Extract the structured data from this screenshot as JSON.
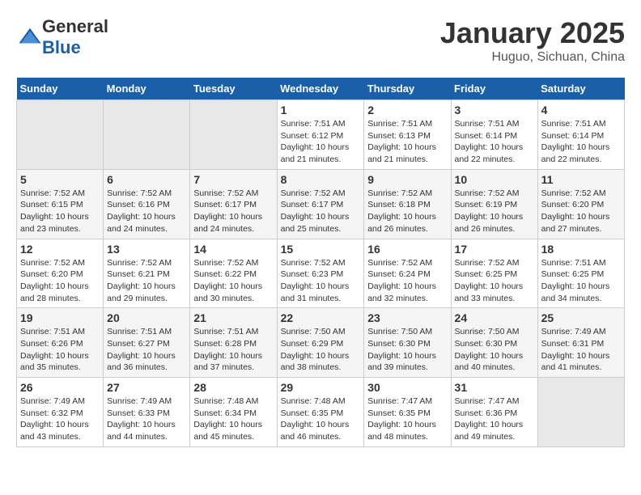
{
  "header": {
    "logo_general": "General",
    "logo_blue": "Blue",
    "month": "January 2025",
    "location": "Huguo, Sichuan, China"
  },
  "weekdays": [
    "Sunday",
    "Monday",
    "Tuesday",
    "Wednesday",
    "Thursday",
    "Friday",
    "Saturday"
  ],
  "weeks": [
    [
      {
        "day": "",
        "info": ""
      },
      {
        "day": "",
        "info": ""
      },
      {
        "day": "",
        "info": ""
      },
      {
        "day": "1",
        "info": "Sunrise: 7:51 AM\nSunset: 6:12 PM\nDaylight: 10 hours\nand 21 minutes."
      },
      {
        "day": "2",
        "info": "Sunrise: 7:51 AM\nSunset: 6:13 PM\nDaylight: 10 hours\nand 21 minutes."
      },
      {
        "day": "3",
        "info": "Sunrise: 7:51 AM\nSunset: 6:14 PM\nDaylight: 10 hours\nand 22 minutes."
      },
      {
        "day": "4",
        "info": "Sunrise: 7:51 AM\nSunset: 6:14 PM\nDaylight: 10 hours\nand 22 minutes."
      }
    ],
    [
      {
        "day": "5",
        "info": "Sunrise: 7:52 AM\nSunset: 6:15 PM\nDaylight: 10 hours\nand 23 minutes."
      },
      {
        "day": "6",
        "info": "Sunrise: 7:52 AM\nSunset: 6:16 PM\nDaylight: 10 hours\nand 24 minutes."
      },
      {
        "day": "7",
        "info": "Sunrise: 7:52 AM\nSunset: 6:17 PM\nDaylight: 10 hours\nand 24 minutes."
      },
      {
        "day": "8",
        "info": "Sunrise: 7:52 AM\nSunset: 6:17 PM\nDaylight: 10 hours\nand 25 minutes."
      },
      {
        "day": "9",
        "info": "Sunrise: 7:52 AM\nSunset: 6:18 PM\nDaylight: 10 hours\nand 26 minutes."
      },
      {
        "day": "10",
        "info": "Sunrise: 7:52 AM\nSunset: 6:19 PM\nDaylight: 10 hours\nand 26 minutes."
      },
      {
        "day": "11",
        "info": "Sunrise: 7:52 AM\nSunset: 6:20 PM\nDaylight: 10 hours\nand 27 minutes."
      }
    ],
    [
      {
        "day": "12",
        "info": "Sunrise: 7:52 AM\nSunset: 6:20 PM\nDaylight: 10 hours\nand 28 minutes."
      },
      {
        "day": "13",
        "info": "Sunrise: 7:52 AM\nSunset: 6:21 PM\nDaylight: 10 hours\nand 29 minutes."
      },
      {
        "day": "14",
        "info": "Sunrise: 7:52 AM\nSunset: 6:22 PM\nDaylight: 10 hours\nand 30 minutes."
      },
      {
        "day": "15",
        "info": "Sunrise: 7:52 AM\nSunset: 6:23 PM\nDaylight: 10 hours\nand 31 minutes."
      },
      {
        "day": "16",
        "info": "Sunrise: 7:52 AM\nSunset: 6:24 PM\nDaylight: 10 hours\nand 32 minutes."
      },
      {
        "day": "17",
        "info": "Sunrise: 7:52 AM\nSunset: 6:25 PM\nDaylight: 10 hours\nand 33 minutes."
      },
      {
        "day": "18",
        "info": "Sunrise: 7:51 AM\nSunset: 6:25 PM\nDaylight: 10 hours\nand 34 minutes."
      }
    ],
    [
      {
        "day": "19",
        "info": "Sunrise: 7:51 AM\nSunset: 6:26 PM\nDaylight: 10 hours\nand 35 minutes."
      },
      {
        "day": "20",
        "info": "Sunrise: 7:51 AM\nSunset: 6:27 PM\nDaylight: 10 hours\nand 36 minutes."
      },
      {
        "day": "21",
        "info": "Sunrise: 7:51 AM\nSunset: 6:28 PM\nDaylight: 10 hours\nand 37 minutes."
      },
      {
        "day": "22",
        "info": "Sunrise: 7:50 AM\nSunset: 6:29 PM\nDaylight: 10 hours\nand 38 minutes."
      },
      {
        "day": "23",
        "info": "Sunrise: 7:50 AM\nSunset: 6:30 PM\nDaylight: 10 hours\nand 39 minutes."
      },
      {
        "day": "24",
        "info": "Sunrise: 7:50 AM\nSunset: 6:30 PM\nDaylight: 10 hours\nand 40 minutes."
      },
      {
        "day": "25",
        "info": "Sunrise: 7:49 AM\nSunset: 6:31 PM\nDaylight: 10 hours\nand 41 minutes."
      }
    ],
    [
      {
        "day": "26",
        "info": "Sunrise: 7:49 AM\nSunset: 6:32 PM\nDaylight: 10 hours\nand 43 minutes."
      },
      {
        "day": "27",
        "info": "Sunrise: 7:49 AM\nSunset: 6:33 PM\nDaylight: 10 hours\nand 44 minutes."
      },
      {
        "day": "28",
        "info": "Sunrise: 7:48 AM\nSunset: 6:34 PM\nDaylight: 10 hours\nand 45 minutes."
      },
      {
        "day": "29",
        "info": "Sunrise: 7:48 AM\nSunset: 6:35 PM\nDaylight: 10 hours\nand 46 minutes."
      },
      {
        "day": "30",
        "info": "Sunrise: 7:47 AM\nSunset: 6:35 PM\nDaylight: 10 hours\nand 48 minutes."
      },
      {
        "day": "31",
        "info": "Sunrise: 7:47 AM\nSunset: 6:36 PM\nDaylight: 10 hours\nand 49 minutes."
      },
      {
        "day": "",
        "info": ""
      }
    ]
  ]
}
